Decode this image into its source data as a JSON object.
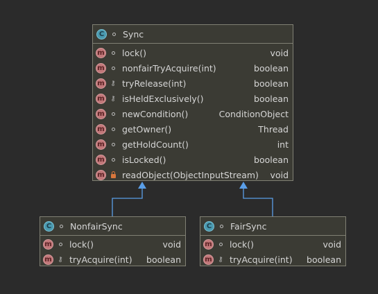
{
  "sync": {
    "title": "Sync",
    "icon": "class-icon",
    "methods": [
      {
        "name": "lock()",
        "type": "void",
        "visibility": "public"
      },
      {
        "name": "nonfairTryAcquire(int)",
        "type": "boolean",
        "visibility": "public"
      },
      {
        "name": "tryRelease(int)",
        "type": "boolean",
        "visibility": "protected"
      },
      {
        "name": "isHeldExclusively()",
        "type": "boolean",
        "visibility": "protected"
      },
      {
        "name": "newCondition()",
        "type": "ConditionObject",
        "visibility": "public"
      },
      {
        "name": "getOwner()",
        "type": "Thread",
        "visibility": "public"
      },
      {
        "name": "getHoldCount()",
        "type": "int",
        "visibility": "public"
      },
      {
        "name": "isLocked()",
        "type": "boolean",
        "visibility": "public"
      },
      {
        "name": "readObject(ObjectInputStream)",
        "type": "void",
        "visibility": "private"
      }
    ]
  },
  "nonfair": {
    "title": "NonfairSync",
    "methods": [
      {
        "name": "lock()",
        "type": "void",
        "visibility": "public"
      },
      {
        "name": "tryAcquire(int)",
        "type": "boolean",
        "visibility": "protected"
      }
    ]
  },
  "fair": {
    "title": "FairSync",
    "methods": [
      {
        "name": "lock()",
        "type": "void",
        "visibility": "public"
      },
      {
        "name": "tryAcquire(int)",
        "type": "boolean",
        "visibility": "protected"
      }
    ]
  },
  "icons": {
    "class_letter": "C",
    "method_letter": "m"
  },
  "colors": {
    "background": "#2b2b2b",
    "box": "#3b3b34",
    "arrow": "#5a9ee8"
  }
}
